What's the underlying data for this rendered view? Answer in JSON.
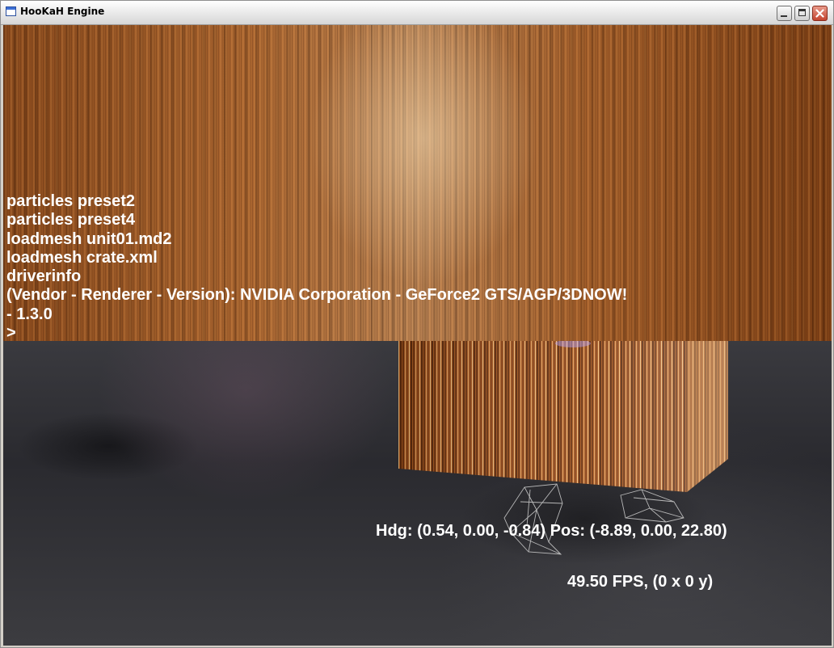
{
  "window": {
    "title": "HooKaH Engine",
    "icon": "window-app-icon",
    "controls": [
      "minimize-icon",
      "maximize-icon",
      "close-icon"
    ]
  },
  "console": {
    "lines": [
      "particles preset2",
      "particles preset4",
      "loadmesh unit01.md2",
      "loadmesh crate.xml",
      "driverinfo",
      "(Vendor - Renderer - Version): NVIDIA Corporation - GeForce2 GTS/AGP/3DNOW!",
      "- 1.3.0",
      ">"
    ]
  },
  "hud": {
    "heading_position": "Hdg: (0.54, 0.00, -0.84) Pos: (-8.89, 0.00, 22.80)",
    "fps": "49.50 FPS, (0 x 0 y)"
  },
  "colors": {
    "console_text": "#ffffff",
    "crate_wood": "#b8652a",
    "floor": "#2e2e33",
    "wireframe": "#c8c8c8"
  }
}
